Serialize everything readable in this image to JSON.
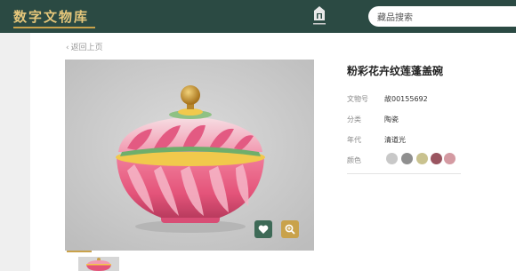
{
  "header": {
    "brand": "数字文物库",
    "search_placeholder": "藏品搜索"
  },
  "nav": {
    "back_label": "返回上页"
  },
  "artifact": {
    "title": "粉彩花卉纹莲蓬盖碗",
    "fields": [
      {
        "label": "文物号",
        "value": "故00155692"
      },
      {
        "label": "分类",
        "value": "陶瓷"
      },
      {
        "label": "年代",
        "value": "清道光"
      },
      {
        "label": "颜色",
        "value": ""
      }
    ],
    "colors": [
      "#c8c8c8",
      "#8f8f8f",
      "#c9c28f",
      "#9a5560",
      "#d49aa2"
    ]
  },
  "actions": {
    "favorite_icon": "heart-icon",
    "zoom_icon": "zoom-in-icon"
  },
  "theme": {
    "header_bg": "#2b4a43",
    "accent": "#c9a24b",
    "favorite_bg": "#3e6a57"
  }
}
